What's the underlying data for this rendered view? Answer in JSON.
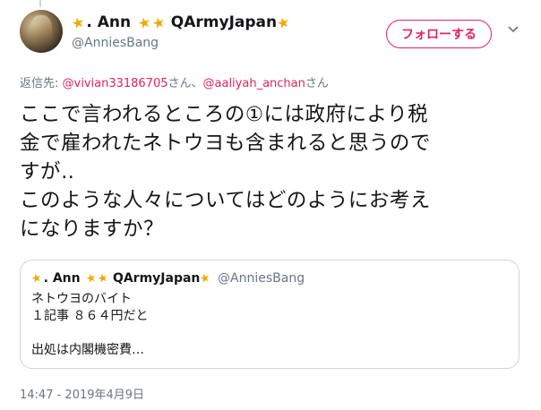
{
  "author": {
    "name_prefix": ". Ann",
    "name_suffix": "QArmyJapan",
    "handle": "@AnniesBang"
  },
  "follow_button_label": "フォローする",
  "reply_to": {
    "prefix": "返信先: ",
    "user1": "@vivian33186705",
    "middle": "さん、",
    "user2": "@aaliyah_anchan",
    "suffix": "さん"
  },
  "tweet_lines": [
    "ここで言われるところの①には政府により税",
    "金で雇われたネトウヨも含まれると思うので",
    "すが‥",
    "このような人々についてはどのようにお考え",
    "になりますか？"
  ],
  "quote": {
    "name_prefix": ". Ann",
    "name_suffix": "QArmyJapan",
    "handle": "@AnniesBang",
    "lines": [
      "ネトウヨのバイト",
      "１記事 ８６４円だと",
      "",
      "出処は内閣機密費…"
    ]
  },
  "timestamp": "14:47 - 2019年4月9日",
  "colors": {
    "accent": "#e0245e",
    "secondary_text": "#657786",
    "border": "#ccd6dd",
    "star": "#f2a900"
  },
  "icons": [
    "star-emoji-icon",
    "chevron-down-icon"
  ]
}
